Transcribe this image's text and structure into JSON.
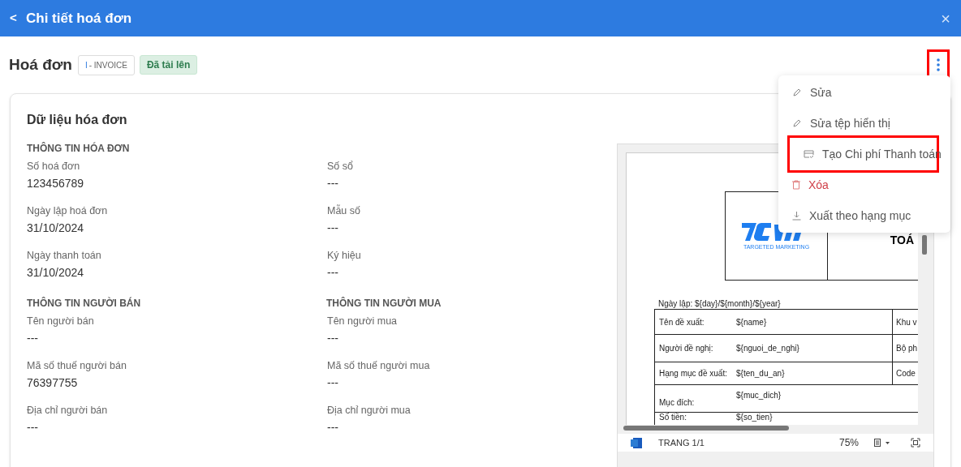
{
  "header": {
    "back": "<",
    "title": "Chi tiết hoá đơn",
    "close": "×"
  },
  "page": {
    "title": "Hoá đơn",
    "type_badge": {
      "mark": "I",
      "text": "- INVOICE"
    },
    "status_badge": "Đã tải lên",
    "more_button": {
      "highlighted": true
    }
  },
  "card": {
    "title": "Dữ liệu hóa đơn",
    "sections": [
      {
        "title": "THÔNG TIN HÓA ĐƠN",
        "fields": [
          {
            "label": "Số hoá đơn",
            "value": "123456789"
          },
          {
            "label": "Số sổ",
            "value": "---"
          },
          {
            "label": "Ngày lập hoá đơn",
            "value": "31/10/2024"
          },
          {
            "label": "Mẫu số",
            "value": "---"
          },
          {
            "label": "Ngày thanh toán",
            "value": "31/10/2024"
          },
          {
            "label": "Ký hiệu",
            "value": "---"
          }
        ]
      },
      {
        "title": "THÔNG TIN NGƯỜI BÁN",
        "title_right": "THÔNG TIN NGƯỜI MUA",
        "fields": [
          {
            "label": "Tên người bán",
            "value": "---"
          },
          {
            "label": "Tên người mua",
            "value": "---"
          },
          {
            "label": "Mã số thuế người bán",
            "value": "76397755"
          },
          {
            "label": "Mã số thuế người mua",
            "value": "---"
          },
          {
            "label": "Địa chỉ người bán",
            "value": "---"
          },
          {
            "label": "Địa chỉ người mua",
            "value": "---"
          }
        ]
      }
    ]
  },
  "preview": {
    "logo_caption": "TARGETED MARKETING",
    "heading": "TOÁ",
    "date_line": "Ngày lập: ${day}/${month}/${year}",
    "rows": [
      {
        "label": "Tên đề xuất:",
        "value": "${name}",
        "right": "Khu v"
      },
      {
        "label": "Người đề nghị:",
        "value": "${nguoi_de_nghi}",
        "right": "Bộ ph"
      },
      {
        "label": "Hạng mục đề xuất:",
        "value": "${ten_du_an}",
        "right": "Code"
      },
      {
        "label": "Mục đích:",
        "value": "${muc_dich}"
      },
      {
        "label": "Số tiền:",
        "value": "${so_tien}"
      }
    ],
    "toolbar": {
      "page": "TRANG 1/1",
      "zoom": "75%"
    }
  },
  "menu": [
    {
      "kind": "edit",
      "label": "Sửa",
      "highlighted": false
    },
    {
      "kind": "edit",
      "label": "Sửa tệp hiển thị",
      "highlighted": false
    },
    {
      "kind": "payment",
      "label": "Tạo Chi phí Thanh toán",
      "highlighted": true
    },
    {
      "kind": "delete",
      "label": "Xóa",
      "highlighted": false
    },
    {
      "kind": "export",
      "label": "Xuất theo hạng mục",
      "highlighted": false
    }
  ]
}
